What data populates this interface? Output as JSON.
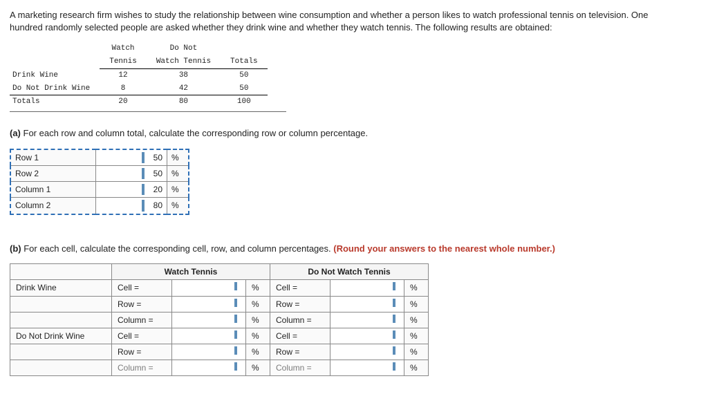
{
  "intro": "A marketing research firm wishes to study the relationship between wine consumption and whether a person likes to watch professional tennis on television. One hundred randomly selected people are asked whether they drink wine and whether they watch tennis. The following results are obtained:",
  "contingency": {
    "col1_line1": "Watch",
    "col1_line2": "Tennis",
    "col2_line1": "Do Not",
    "col2_line2": "Watch Tennis",
    "col3": "Totals",
    "row1_label": "Drink Wine",
    "row2_label": "Do Not Drink Wine",
    "row3_label": "Totals",
    "r1c1": "12",
    "r1c2": "38",
    "r1c3": "50",
    "r2c1": "8",
    "r2c2": "42",
    "r2c3": "50",
    "r3c1": "20",
    "r3c2": "80",
    "r3c3": "100"
  },
  "partA": {
    "prompt_prefix": "(a)",
    "prompt": " For each row and column total, calculate the corresponding row or column percentage.",
    "rows": [
      {
        "label": "Row 1",
        "value": "50",
        "unit": "%"
      },
      {
        "label": "Row 2",
        "value": "50",
        "unit": "%"
      },
      {
        "label": "Column 1",
        "value": "20",
        "unit": "%"
      },
      {
        "label": "Column 2",
        "value": "80",
        "unit": "%"
      }
    ]
  },
  "partB": {
    "prompt_prefix": "(b)",
    "prompt": " For each cell, calculate the corresponding cell, row, and column percentages. ",
    "prompt_red": "(Round your answers to the nearest whole number.)",
    "col1_header": "Watch Tennis",
    "col2_header": "Do Not Watch Tennis",
    "group1_label": "Drink Wine",
    "group2_label": "Do Not Drink Wine",
    "cell_label": "Cell =",
    "row_label": "Row =",
    "col_label": "Column =",
    "unit": "%"
  }
}
